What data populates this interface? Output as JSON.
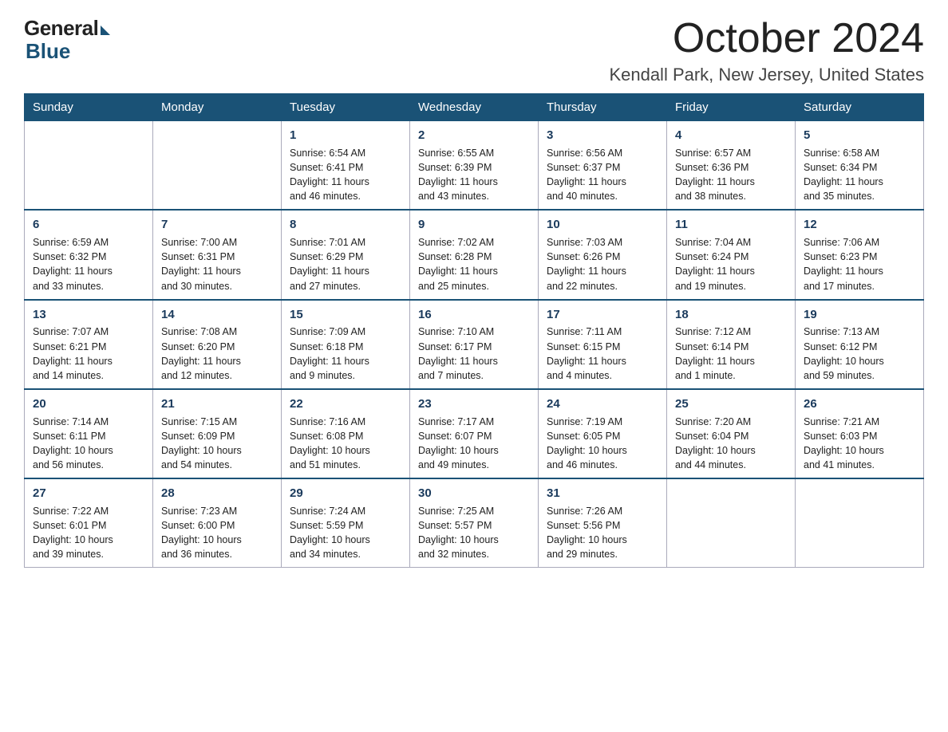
{
  "logo": {
    "general": "General",
    "blue": "Blue"
  },
  "title": "October 2024",
  "subtitle": "Kendall Park, New Jersey, United States",
  "weekdays": [
    "Sunday",
    "Monday",
    "Tuesday",
    "Wednesday",
    "Thursday",
    "Friday",
    "Saturday"
  ],
  "weeks": [
    [
      {
        "day": "",
        "info": ""
      },
      {
        "day": "",
        "info": ""
      },
      {
        "day": "1",
        "info": "Sunrise: 6:54 AM\nSunset: 6:41 PM\nDaylight: 11 hours\nand 46 minutes."
      },
      {
        "day": "2",
        "info": "Sunrise: 6:55 AM\nSunset: 6:39 PM\nDaylight: 11 hours\nand 43 minutes."
      },
      {
        "day": "3",
        "info": "Sunrise: 6:56 AM\nSunset: 6:37 PM\nDaylight: 11 hours\nand 40 minutes."
      },
      {
        "day": "4",
        "info": "Sunrise: 6:57 AM\nSunset: 6:36 PM\nDaylight: 11 hours\nand 38 minutes."
      },
      {
        "day": "5",
        "info": "Sunrise: 6:58 AM\nSunset: 6:34 PM\nDaylight: 11 hours\nand 35 minutes."
      }
    ],
    [
      {
        "day": "6",
        "info": "Sunrise: 6:59 AM\nSunset: 6:32 PM\nDaylight: 11 hours\nand 33 minutes."
      },
      {
        "day": "7",
        "info": "Sunrise: 7:00 AM\nSunset: 6:31 PM\nDaylight: 11 hours\nand 30 minutes."
      },
      {
        "day": "8",
        "info": "Sunrise: 7:01 AM\nSunset: 6:29 PM\nDaylight: 11 hours\nand 27 minutes."
      },
      {
        "day": "9",
        "info": "Sunrise: 7:02 AM\nSunset: 6:28 PM\nDaylight: 11 hours\nand 25 minutes."
      },
      {
        "day": "10",
        "info": "Sunrise: 7:03 AM\nSunset: 6:26 PM\nDaylight: 11 hours\nand 22 minutes."
      },
      {
        "day": "11",
        "info": "Sunrise: 7:04 AM\nSunset: 6:24 PM\nDaylight: 11 hours\nand 19 minutes."
      },
      {
        "day": "12",
        "info": "Sunrise: 7:06 AM\nSunset: 6:23 PM\nDaylight: 11 hours\nand 17 minutes."
      }
    ],
    [
      {
        "day": "13",
        "info": "Sunrise: 7:07 AM\nSunset: 6:21 PM\nDaylight: 11 hours\nand 14 minutes."
      },
      {
        "day": "14",
        "info": "Sunrise: 7:08 AM\nSunset: 6:20 PM\nDaylight: 11 hours\nand 12 minutes."
      },
      {
        "day": "15",
        "info": "Sunrise: 7:09 AM\nSunset: 6:18 PM\nDaylight: 11 hours\nand 9 minutes."
      },
      {
        "day": "16",
        "info": "Sunrise: 7:10 AM\nSunset: 6:17 PM\nDaylight: 11 hours\nand 7 minutes."
      },
      {
        "day": "17",
        "info": "Sunrise: 7:11 AM\nSunset: 6:15 PM\nDaylight: 11 hours\nand 4 minutes."
      },
      {
        "day": "18",
        "info": "Sunrise: 7:12 AM\nSunset: 6:14 PM\nDaylight: 11 hours\nand 1 minute."
      },
      {
        "day": "19",
        "info": "Sunrise: 7:13 AM\nSunset: 6:12 PM\nDaylight: 10 hours\nand 59 minutes."
      }
    ],
    [
      {
        "day": "20",
        "info": "Sunrise: 7:14 AM\nSunset: 6:11 PM\nDaylight: 10 hours\nand 56 minutes."
      },
      {
        "day": "21",
        "info": "Sunrise: 7:15 AM\nSunset: 6:09 PM\nDaylight: 10 hours\nand 54 minutes."
      },
      {
        "day": "22",
        "info": "Sunrise: 7:16 AM\nSunset: 6:08 PM\nDaylight: 10 hours\nand 51 minutes."
      },
      {
        "day": "23",
        "info": "Sunrise: 7:17 AM\nSunset: 6:07 PM\nDaylight: 10 hours\nand 49 minutes."
      },
      {
        "day": "24",
        "info": "Sunrise: 7:19 AM\nSunset: 6:05 PM\nDaylight: 10 hours\nand 46 minutes."
      },
      {
        "day": "25",
        "info": "Sunrise: 7:20 AM\nSunset: 6:04 PM\nDaylight: 10 hours\nand 44 minutes."
      },
      {
        "day": "26",
        "info": "Sunrise: 7:21 AM\nSunset: 6:03 PM\nDaylight: 10 hours\nand 41 minutes."
      }
    ],
    [
      {
        "day": "27",
        "info": "Sunrise: 7:22 AM\nSunset: 6:01 PM\nDaylight: 10 hours\nand 39 minutes."
      },
      {
        "day": "28",
        "info": "Sunrise: 7:23 AM\nSunset: 6:00 PM\nDaylight: 10 hours\nand 36 minutes."
      },
      {
        "day": "29",
        "info": "Sunrise: 7:24 AM\nSunset: 5:59 PM\nDaylight: 10 hours\nand 34 minutes."
      },
      {
        "day": "30",
        "info": "Sunrise: 7:25 AM\nSunset: 5:57 PM\nDaylight: 10 hours\nand 32 minutes."
      },
      {
        "day": "31",
        "info": "Sunrise: 7:26 AM\nSunset: 5:56 PM\nDaylight: 10 hours\nand 29 minutes."
      },
      {
        "day": "",
        "info": ""
      },
      {
        "day": "",
        "info": ""
      }
    ]
  ]
}
